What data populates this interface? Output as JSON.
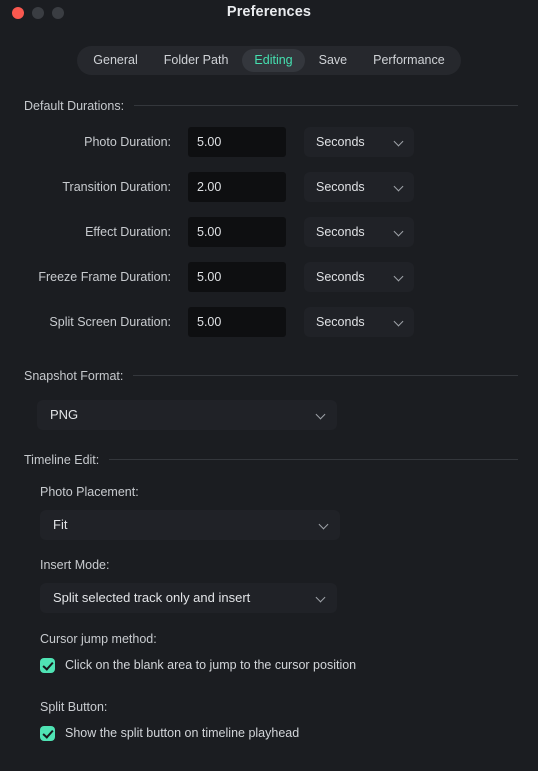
{
  "window": {
    "title": "Preferences",
    "traffic_lights": [
      "close",
      "minimize",
      "zoom"
    ]
  },
  "tabs": [
    {
      "label": "General",
      "active": false
    },
    {
      "label": "Folder Path",
      "active": false
    },
    {
      "label": "Editing",
      "active": true
    },
    {
      "label": "Save",
      "active": false
    },
    {
      "label": "Performance",
      "active": false
    }
  ],
  "sections": {
    "default_durations": {
      "title": "Default Durations:",
      "rows": [
        {
          "label": "Photo Duration:",
          "value": "5.00",
          "unit": "Seconds"
        },
        {
          "label": "Transition Duration:",
          "value": "2.00",
          "unit": "Seconds"
        },
        {
          "label": "Effect Duration:",
          "value": "5.00",
          "unit": "Seconds"
        },
        {
          "label": "Freeze Frame Duration:",
          "value": "5.00",
          "unit": "Seconds"
        },
        {
          "label": "Split Screen Duration:",
          "value": "5.00",
          "unit": "Seconds"
        }
      ]
    },
    "snapshot_format": {
      "title": "Snapshot Format:",
      "value": "PNG"
    },
    "timeline_edit": {
      "title": "Timeline Edit:",
      "photo_placement": {
        "label": "Photo Placement:",
        "value": "Fit"
      },
      "insert_mode": {
        "label": "Insert Mode:",
        "value": "Split selected track only and insert"
      },
      "cursor_jump": {
        "label": "Cursor jump method:",
        "checkbox_label": "Click on the blank area to jump to the cursor position",
        "checked": true
      },
      "split_button": {
        "label": "Split Button:",
        "checkbox_label": "Show the split button on timeline playhead",
        "checked": true
      }
    }
  },
  "colors": {
    "background": "#1b1d21",
    "accent_teal": "#45e0b0",
    "close_red": "#f9584f",
    "field_dark": "#0e0f11",
    "control_gray": "#202227"
  }
}
